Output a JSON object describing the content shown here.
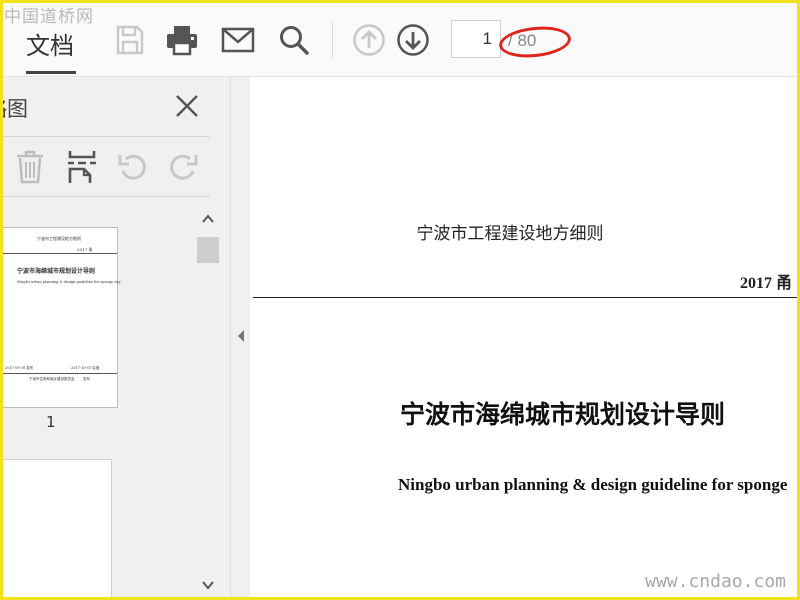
{
  "watermark": {
    "top": "中国道桥网",
    "bottom": "www.cndao.com"
  },
  "toolbar": {
    "doc_tab": "文档",
    "icons": [
      "save-icon",
      "print-icon",
      "mail-icon",
      "search-icon",
      "arrow-up-icon",
      "arrow-down-icon"
    ],
    "page_current": "1",
    "page_total": "/ 80"
  },
  "sidebar": {
    "title": "略图",
    "tools": [
      "trash-icon",
      "split-icon",
      "rotate-left-icon",
      "rotate-right-icon"
    ],
    "thumbnails": [
      {
        "label": "1",
        "lines": {
          "header": "宁波市工程建设地方细则",
          "year": "2017 甬",
          "title": "宁波市海绵城市规划设计导则",
          "subtitle": "Ningbo urban planning & design guideline for sponge city",
          "left_date": "2017-09-30 发布",
          "right_date": "2017-10-01 实施",
          "issuer": "宁波市住房和城乡建设委员会",
          "issuer_suffix": "发布"
        }
      },
      {
        "label": ""
      }
    ]
  },
  "document": {
    "header": "宁波市工程建设地方细则",
    "year": "2017 甬",
    "title": "宁波市海绵城市规划设计导则",
    "subtitle": "Ningbo urban planning & design guideline for sponge"
  },
  "colors": {
    "frame": "#f2e21a",
    "annotation": "#e0231c"
  }
}
